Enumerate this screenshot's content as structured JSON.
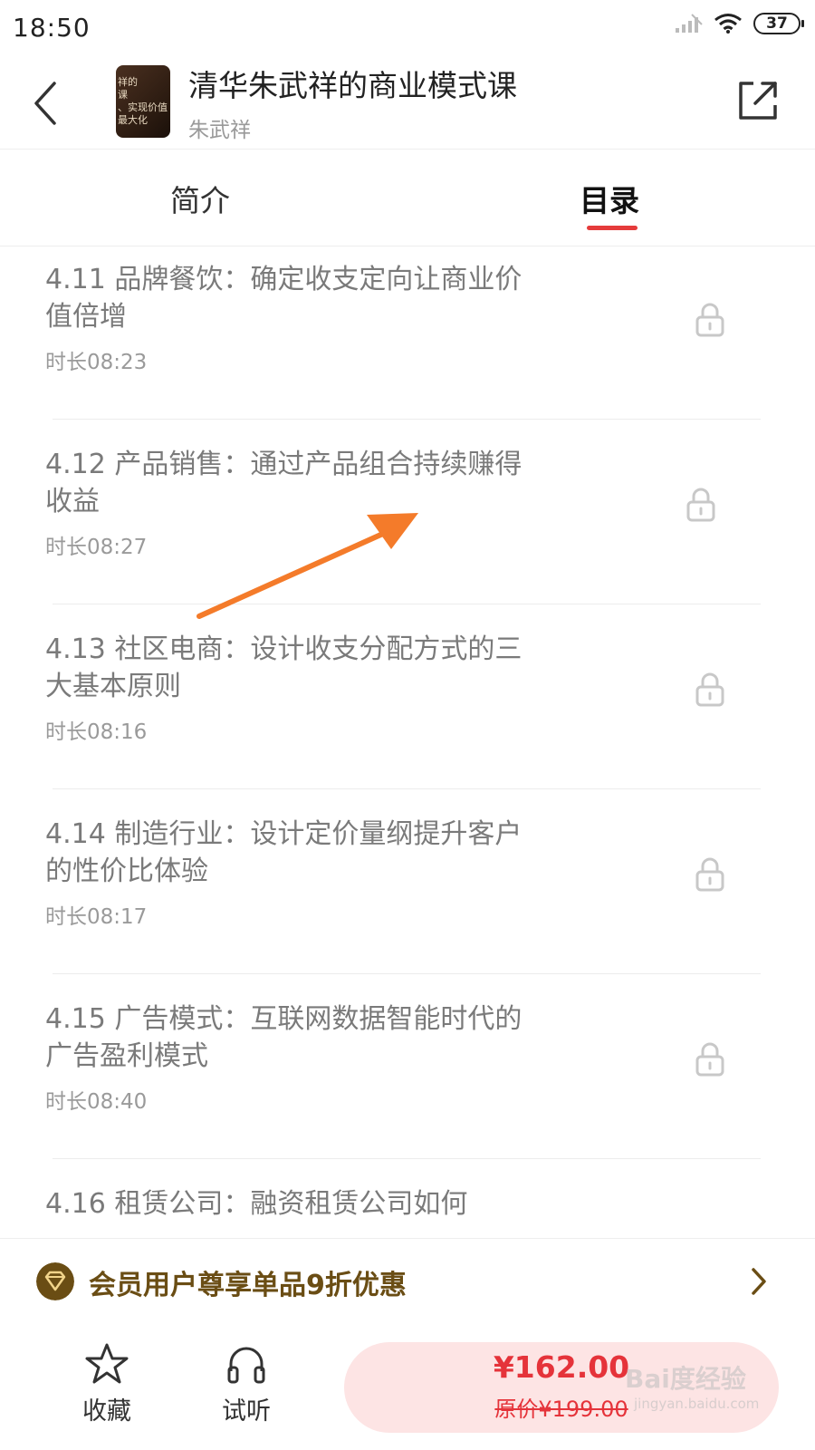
{
  "status_bar": {
    "time": "18:50",
    "battery": "37"
  },
  "header": {
    "title": "清华朱武祥的商业模式课",
    "author": "朱武祥",
    "cover_text": "祥的\n课\n、实现价值最大化",
    "icons": {
      "back": "back-chevron-icon",
      "share": "share-icon"
    }
  },
  "tabs": [
    {
      "label": "简介",
      "active": false
    },
    {
      "label": "目录",
      "active": true
    }
  ],
  "accent_color": "#e53b3b",
  "lessons": [
    {
      "title": "4.11 品牌餐饮：确定收支定向让商业价值倍增",
      "duration": "时长08:23",
      "locked": true
    },
    {
      "title": "4.12 产品销售：通过产品组合持续赚得收益",
      "duration": "时长08:27",
      "locked": true
    },
    {
      "title": "4.13 社区电商：设计收支分配方式的三大基本原则",
      "duration": "时长08:16",
      "locked": true
    },
    {
      "title": "4.14 制造行业：设计定价量纲提升客户的性价比体验",
      "duration": "时长08:17",
      "locked": true
    },
    {
      "title": "4.15 广告模式：互联网数据智能时代的广告盈利模式",
      "duration": "时长08:40",
      "locked": true
    },
    {
      "title": "4.16 租赁公司：融资租赁公司如何",
      "duration": "",
      "locked": true
    }
  ],
  "member_banner": {
    "text": "会员用户尊享单品9折优惠"
  },
  "bottom_bar": {
    "favorite_label": "收藏",
    "listen_label": "试听",
    "price": "¥162.00",
    "original_price": "原价¥199.00"
  },
  "watermark": {
    "main": "Bai度经验",
    "sub": "jingyan.baidu.com"
  }
}
